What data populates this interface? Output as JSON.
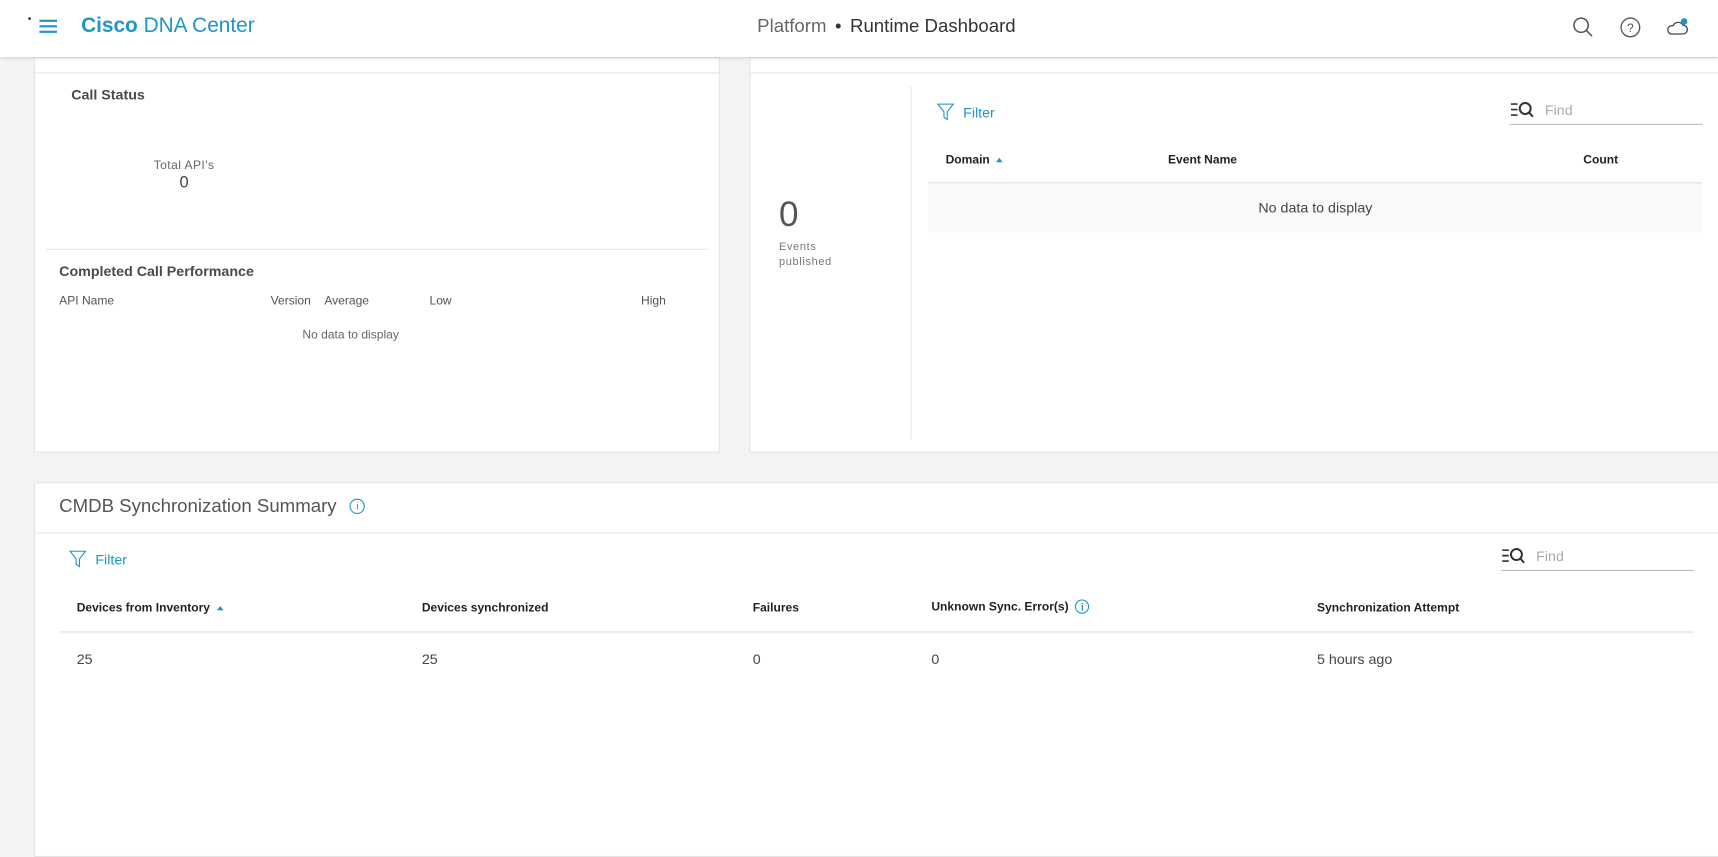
{
  "header": {
    "brand_bold": "Cisco",
    "brand_rest": "DNA Center",
    "breadcrumb_parent": "Platform",
    "breadcrumb_separator": "•",
    "page_title": "Runtime Dashboard",
    "icons": [
      "search-icon",
      "help-icon",
      "cloud-notification-icon"
    ]
  },
  "call_status": {
    "title": "Call Status",
    "total_label": "Total API's",
    "total_value": "0"
  },
  "completed_call_performance": {
    "title": "Completed Call Performance",
    "columns": [
      "API Name",
      "Version",
      "Average",
      "Low",
      "High"
    ],
    "empty_text": "No data to display"
  },
  "events": {
    "count": "0",
    "label_line1": "Events",
    "label_line2": "published",
    "filter_label": "Filter",
    "find_placeholder": "Find",
    "columns": [
      "Domain",
      "Event Name",
      "Count"
    ],
    "sorted_column": "Domain",
    "empty_text": "No data to display"
  },
  "cmdb": {
    "title": "CMDB Synchronization Summary",
    "filter_label": "Filter",
    "find_placeholder": "Find",
    "columns": [
      "Devices from Inventory",
      "Devices synchronized",
      "Failures",
      "Unknown Sync. Error(s)",
      "Synchronization Attempt"
    ],
    "sorted_column": "Devices from Inventory",
    "rows": [
      {
        "devices_from_inventory": "25",
        "devices_synchronized": "25",
        "failures": "0",
        "unknown_sync_errors": "0",
        "synchronization_attempt": "5 hours ago"
      }
    ]
  },
  "colors": {
    "accent": "#1f94c7",
    "background": "#f3f3f3",
    "card": "#ffffff"
  }
}
